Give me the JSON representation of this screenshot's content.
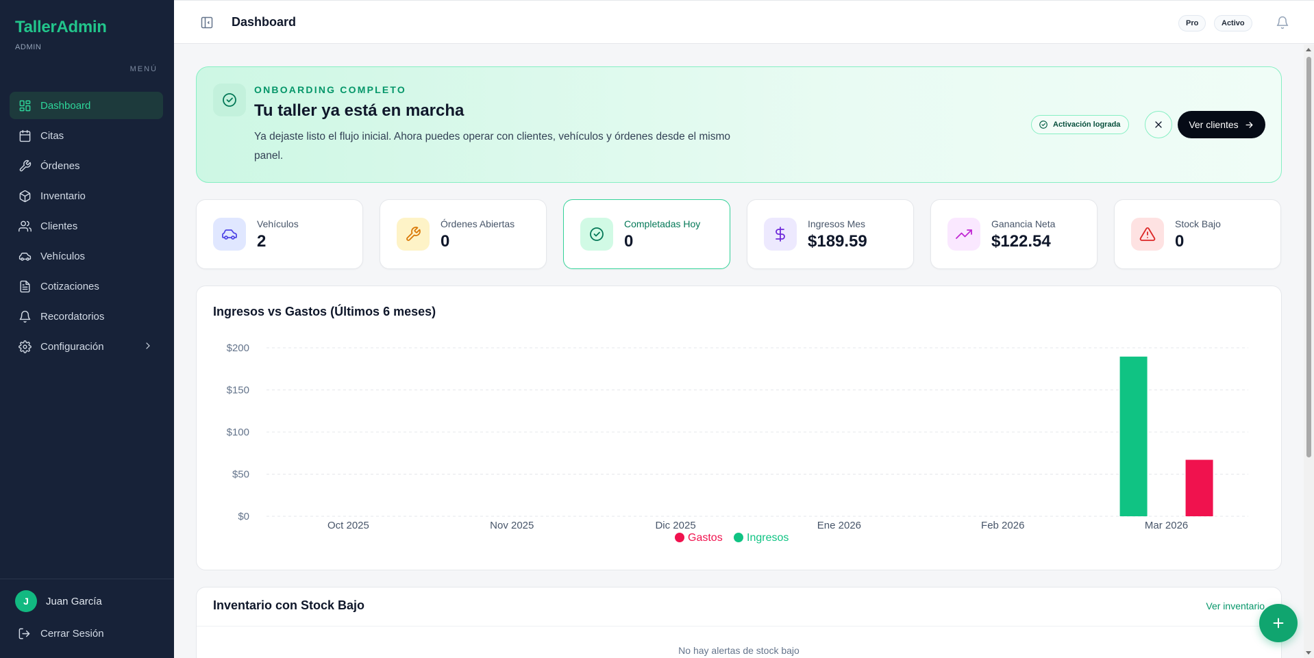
{
  "sidebar": {
    "brand": "TallerAdmin",
    "role": "ADMIN",
    "menu_label": "MENÚ",
    "items": [
      {
        "label": "Dashboard",
        "icon": "dashboard-icon",
        "active": true
      },
      {
        "label": "Citas",
        "icon": "calendar-icon"
      },
      {
        "label": "Órdenes",
        "icon": "wrench-icon"
      },
      {
        "label": "Inventario",
        "icon": "box-icon"
      },
      {
        "label": "Clientes",
        "icon": "users-icon"
      },
      {
        "label": "Vehículos",
        "icon": "car-icon"
      },
      {
        "label": "Cotizaciones",
        "icon": "file-icon"
      },
      {
        "label": "Recordatorios",
        "icon": "bell-icon"
      },
      {
        "label": "Configuración",
        "icon": "gear-icon"
      }
    ],
    "user": {
      "initial": "J",
      "name": "Juan García"
    },
    "logout_label": "Cerrar Sesión"
  },
  "header": {
    "title": "Dashboard",
    "plan_badge": "Pro",
    "status_badge": "Activo"
  },
  "onboarding": {
    "kicker": "ONBOARDING COMPLETO",
    "title": "Tu taller ya está en marcha",
    "description": "Ya dejaste listo el flujo inicial. Ahora puedes operar con clientes, vehículos y órdenes desde el mismo panel.",
    "badge": "Activación lograda",
    "cta": "Ver clientes"
  },
  "stats": [
    {
      "label": "Vehículos",
      "value": "2",
      "icon": "car-icon",
      "color": "#4f46e5",
      "bg": "#e0e7ff"
    },
    {
      "label": "Órdenes Abiertas",
      "value": "0",
      "icon": "wrench-icon",
      "color": "#d97706",
      "bg": "#fef3c7"
    },
    {
      "label": "Completadas Hoy",
      "value": "0",
      "icon": "check-circle-icon",
      "color": "#047857",
      "bg": "#d1fae5"
    },
    {
      "label": "Ingresos Mes",
      "value": "$189.59",
      "icon": "dollar-icon",
      "color": "#6d28d9",
      "bg": "#ede9fe"
    },
    {
      "label": "Ganancia Neta",
      "value": "$122.54",
      "icon": "trending-up-icon",
      "color": "#c026d3",
      "bg": "#fae8ff"
    },
    {
      "label": "Stock Bajo",
      "value": "0",
      "icon": "alert-triangle-icon",
      "color": "#dc2626",
      "bg": "#fee2e2"
    }
  ],
  "chart_title": "Ingresos vs Gastos (Últimos 6 meses)",
  "chart_data": {
    "type": "bar",
    "title": "Ingresos vs Gastos (Últimos 6 meses)",
    "categories": [
      "Oct 2025",
      "Nov 2025",
      "Dic 2025",
      "Ene 2026",
      "Feb 2026",
      "Mar 2026"
    ],
    "series": [
      {
        "name": "Ingresos",
        "color": "#10c383",
        "values": [
          0,
          0,
          0,
          0,
          0,
          189.59
        ]
      },
      {
        "name": "Gastos",
        "color": "#f0124e",
        "values": [
          0,
          0,
          0,
          0,
          0,
          67.05
        ]
      }
    ],
    "y_ticks": [
      "$0",
      "$50",
      "$100",
      "$150",
      "$200"
    ],
    "y_tick_values": [
      0,
      50,
      100,
      150,
      200
    ],
    "ylim": [
      0,
      200
    ],
    "grid": true,
    "legend_position": "bottom-center",
    "legend_order": [
      "Gastos",
      "Ingresos"
    ]
  },
  "low_stock": {
    "title": "Inventario con Stock Bajo",
    "link": "Ver inventario",
    "empty": "No hay alertas de stock bajo"
  }
}
